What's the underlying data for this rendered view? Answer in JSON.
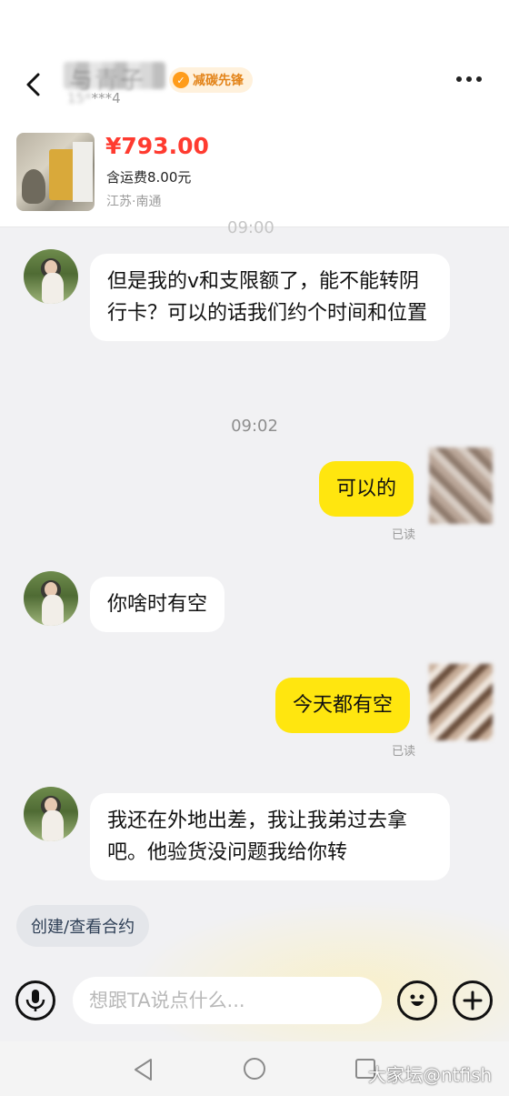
{
  "header": {
    "title": "与青子",
    "subtitle_blurred": "15*",
    "subtitle_visible": "***4",
    "badge_icon": "leaf-icon",
    "badge_label": "减碳先锋"
  },
  "product": {
    "price": "¥793.00",
    "shipping": "含运费8.00元",
    "location": "江苏·南通"
  },
  "messages": [
    {
      "side": "in",
      "text": "但是我的v和支限额了，能不能转阴行卡？可以的话我们约个时间和位置"
    },
    {
      "time": "09:02"
    },
    {
      "side": "out",
      "text": "可以的",
      "status": "已读"
    },
    {
      "side": "in",
      "text": "你啥时有空"
    },
    {
      "side": "out",
      "text": "今天都有空",
      "status": "已读"
    },
    {
      "side": "in",
      "text": "我还在外地出差，我让我弟过去拿吧。他验货没问题我给你转"
    }
  ],
  "contract_button": "创建/查看合约",
  "input": {
    "placeholder": "想跟TA说点什么..."
  },
  "watermark": "大家坛@ntfish",
  "colors": {
    "accent_yellow": "#ffe60f",
    "price_red": "#ff3b30",
    "badge_orange": "#e3841a"
  }
}
